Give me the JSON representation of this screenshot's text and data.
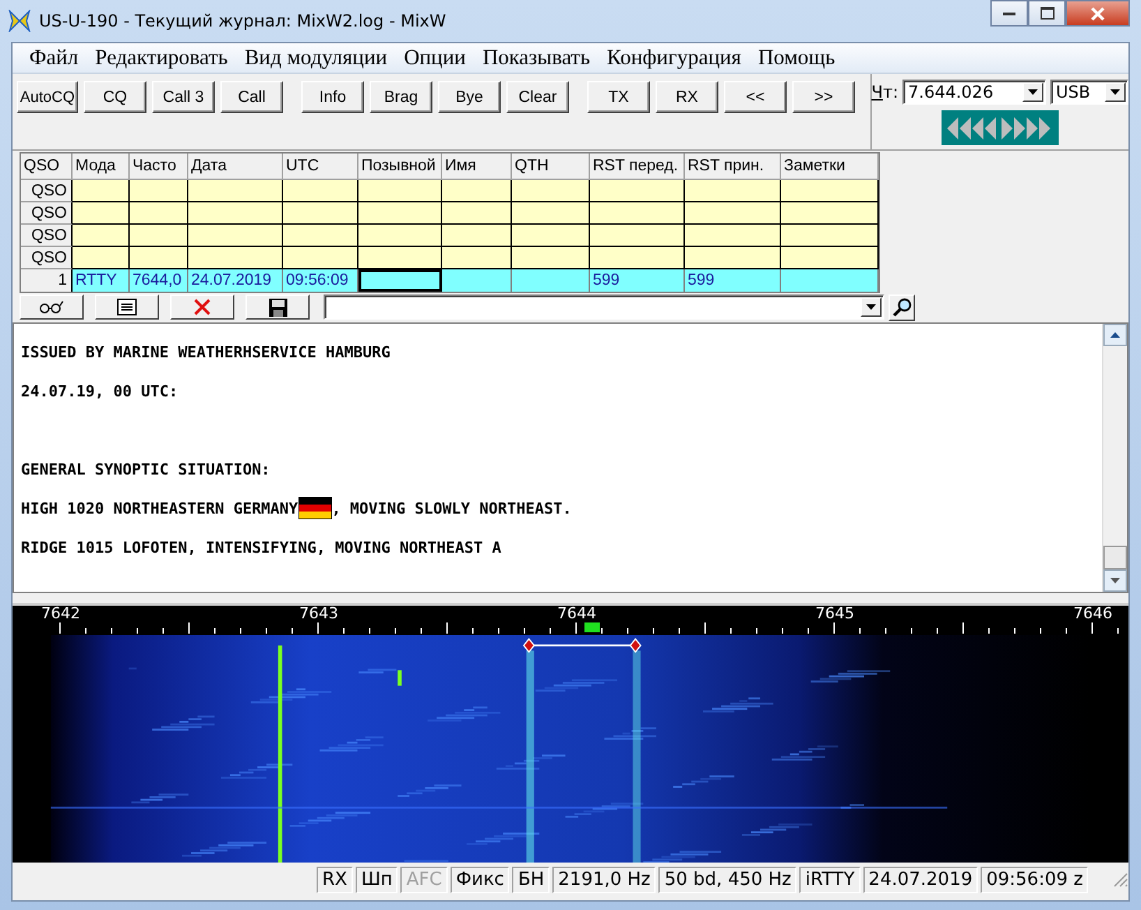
{
  "window": {
    "title": "US-U-190 - Текущий журнал: MixW2.log - MixW"
  },
  "menu": [
    "Файл",
    "Редактировать",
    "Вид модуляции",
    "Опции",
    "Показывать",
    "Конфигурация",
    "Помощь"
  ],
  "toolbar": {
    "groups": [
      [
        "AutoCQ",
        "CQ",
        "Call 3",
        "Call"
      ],
      [
        "Info",
        "Brag",
        "Bye",
        "Clear"
      ],
      [
        "TX",
        "RX",
        "<<",
        ">>"
      ]
    ]
  },
  "tuning": {
    "label": "Чт:",
    "frequency": "7.644.026",
    "mode": "USB"
  },
  "log_table": {
    "columns": [
      "QSO",
      "Мода",
      "Часто",
      "Дата",
      "UTC",
      "Позывной",
      "Имя",
      "QTH",
      "RST перед.",
      "RST прин.",
      "Заметки"
    ],
    "rows": [
      {
        "cells": [
          "QSO",
          "",
          "",
          "",
          "",
          "",
          "",
          "",
          "",
          "",
          ""
        ],
        "selected": false
      },
      {
        "cells": [
          "QSO",
          "",
          "",
          "",
          "",
          "",
          "",
          "",
          "",
          "",
          ""
        ],
        "selected": false
      },
      {
        "cells": [
          "QSO",
          "",
          "",
          "",
          "",
          "",
          "",
          "",
          "",
          "",
          ""
        ],
        "selected": false
      },
      {
        "cells": [
          "QSO",
          "",
          "",
          "",
          "",
          "",
          "",
          "",
          "",
          "",
          ""
        ],
        "selected": false
      },
      {
        "cells": [
          "1",
          "RTTY",
          "7644,0",
          "24.07.2019",
          "09:56:09",
          "",
          "",
          "",
          "599",
          "599",
          ""
        ],
        "selected": true
      }
    ]
  },
  "receive_text": {
    "lines": [
      {
        "text": "ISSUED BY MARINE WEATHERHSERVICE HAMBURG",
        "blank_before": false
      },
      {
        "text": "24.07.19, 00 UTC:",
        "blank_before": false
      },
      {
        "text": "GENERAL SYNOPTIC SITUATION:",
        "blank_before": true
      },
      {
        "text": "HIGH 1020 NORTHEASTERN GERMANY",
        "flag": true,
        "tail": ", MOVING SLOWLY NORTHEAST.",
        "blank_before": false
      },
      {
        "text": "RIDGE 1015 LOFOTEN, INTENSIFYING, MOVING NORTHEAST A",
        "blank_before": false
      }
    ]
  },
  "waterfall": {
    "ruler_labels": [
      "7642",
      "7643",
      "7644",
      "7645",
      "7646"
    ]
  },
  "status_bar": [
    {
      "text": "RX",
      "disabled": false
    },
    {
      "text": "Шп",
      "disabled": false
    },
    {
      "text": "AFC",
      "disabled": true
    },
    {
      "text": "Фикс",
      "disabled": false
    },
    {
      "text": "БН",
      "disabled": false
    },
    {
      "text": "2191,0 Hz",
      "disabled": false
    },
    {
      "text": "50 bd, 450 Hz",
      "disabled": false
    },
    {
      "text": "iRTTY",
      "disabled": false
    },
    {
      "text": "24.07.2019",
      "disabled": false
    },
    {
      "text": "09:56:09 z",
      "disabled": false
    }
  ]
}
